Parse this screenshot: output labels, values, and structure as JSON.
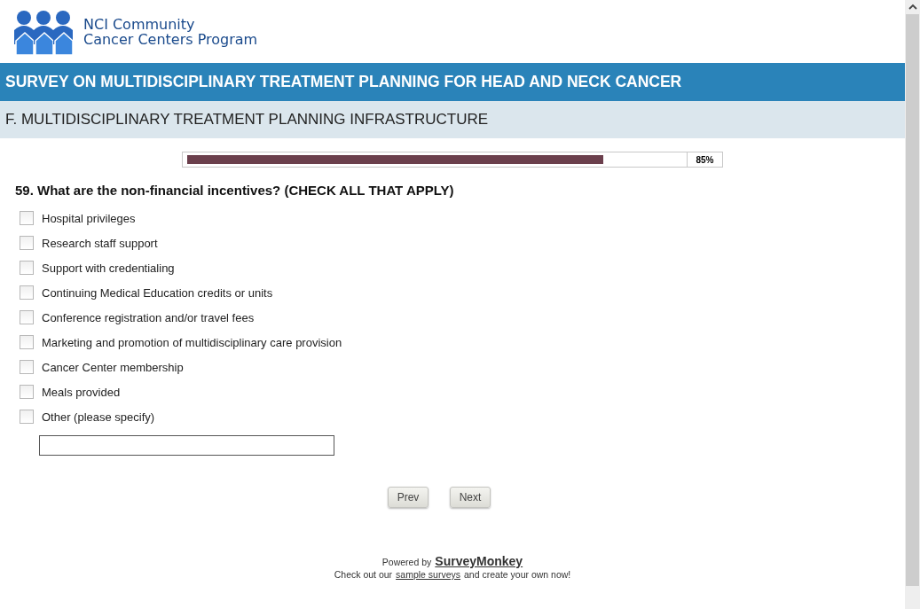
{
  "logo": {
    "line_1": "NCI Community",
    "line_2": "Cancer Centers Program"
  },
  "survey_title": "SURVEY ON MULTIDISCIPLINARY TREATMENT PLANNING FOR HEAD AND NECK CANCER",
  "section_title": "F. MULTIDISCIPLINARY TREATMENT PLANNING INFRASTRUCTURE",
  "progress": {
    "level": 0.84,
    "reading": "85%"
  },
  "question": "59. What are the non-financial incentives? (CHECK ALL THAT APPLY)",
  "options": [
    {
      "label": "Hospital privileges",
      "checked": false
    },
    {
      "label": "Research staff support",
      "checked": false
    },
    {
      "label": "Support with credentialing",
      "checked": false
    },
    {
      "label": "Continuing Medical Education credits or units",
      "checked": false
    },
    {
      "label": "Conference registration and/or travel fees",
      "checked": false
    },
    {
      "label": "Marketing and promotion of multidisciplinary care provision",
      "checked": false
    },
    {
      "label": "Cancer Center membership",
      "checked": false
    },
    {
      "label": "Meals provided",
      "checked": false
    },
    {
      "label": "Other (please specify)",
      "checked": false
    }
  ],
  "buttons": [
    "Prev",
    "Next"
  ],
  "footer": {
    "powered_by": "Powered by",
    "brand": "SurveyMonkey",
    "before_link": "Check out our",
    "link": "sample surveys",
    "after_link": "and create your own now!"
  }
}
